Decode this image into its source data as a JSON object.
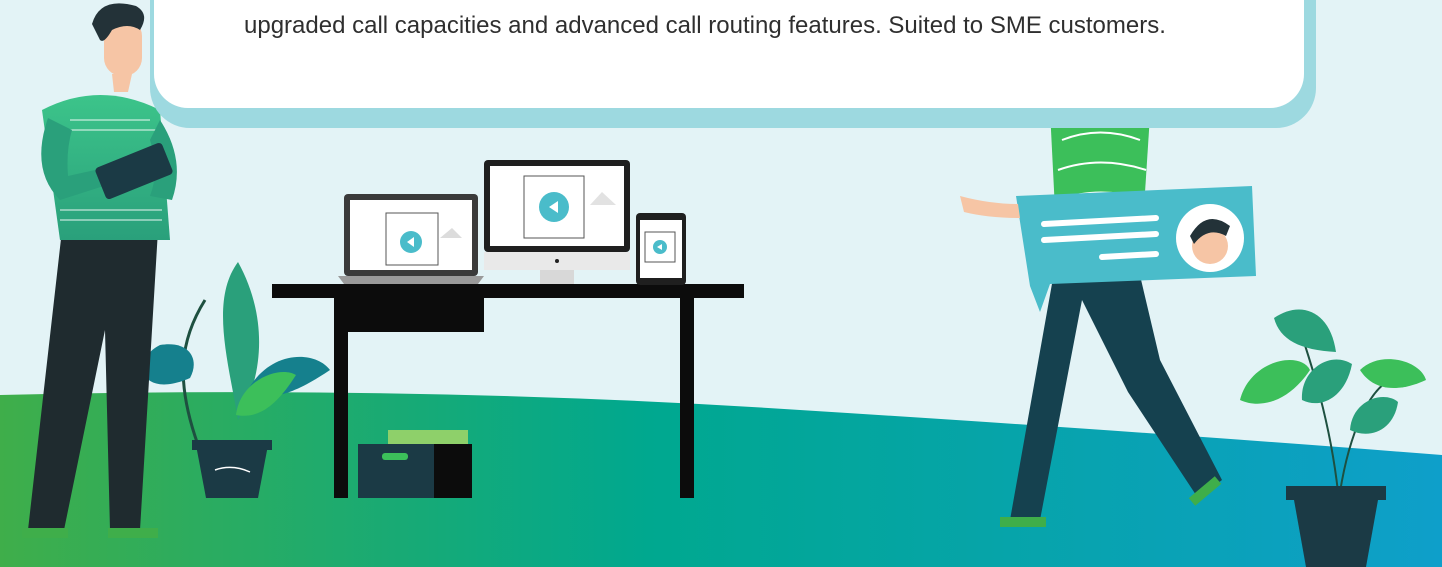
{
  "card": {
    "description": "upgraded call capacities and advanced call routing features. Suited to SME customers."
  },
  "colors": {
    "background": "#e3f3f6",
    "card_border": "#9dd9e0",
    "ground_green": "#3fae4a",
    "ground_teal": "#00a99d",
    "ground_blue": "#0e9fca",
    "accent_teal": "#4abcca",
    "shirt_green": "#3cbf5a",
    "pants_dark": "#1b3a45",
    "desk_black": "#0c0c0c"
  },
  "icons": [
    "play-icon",
    "image-placeholder-icon",
    "chat-bubble-icon",
    "avatar"
  ]
}
